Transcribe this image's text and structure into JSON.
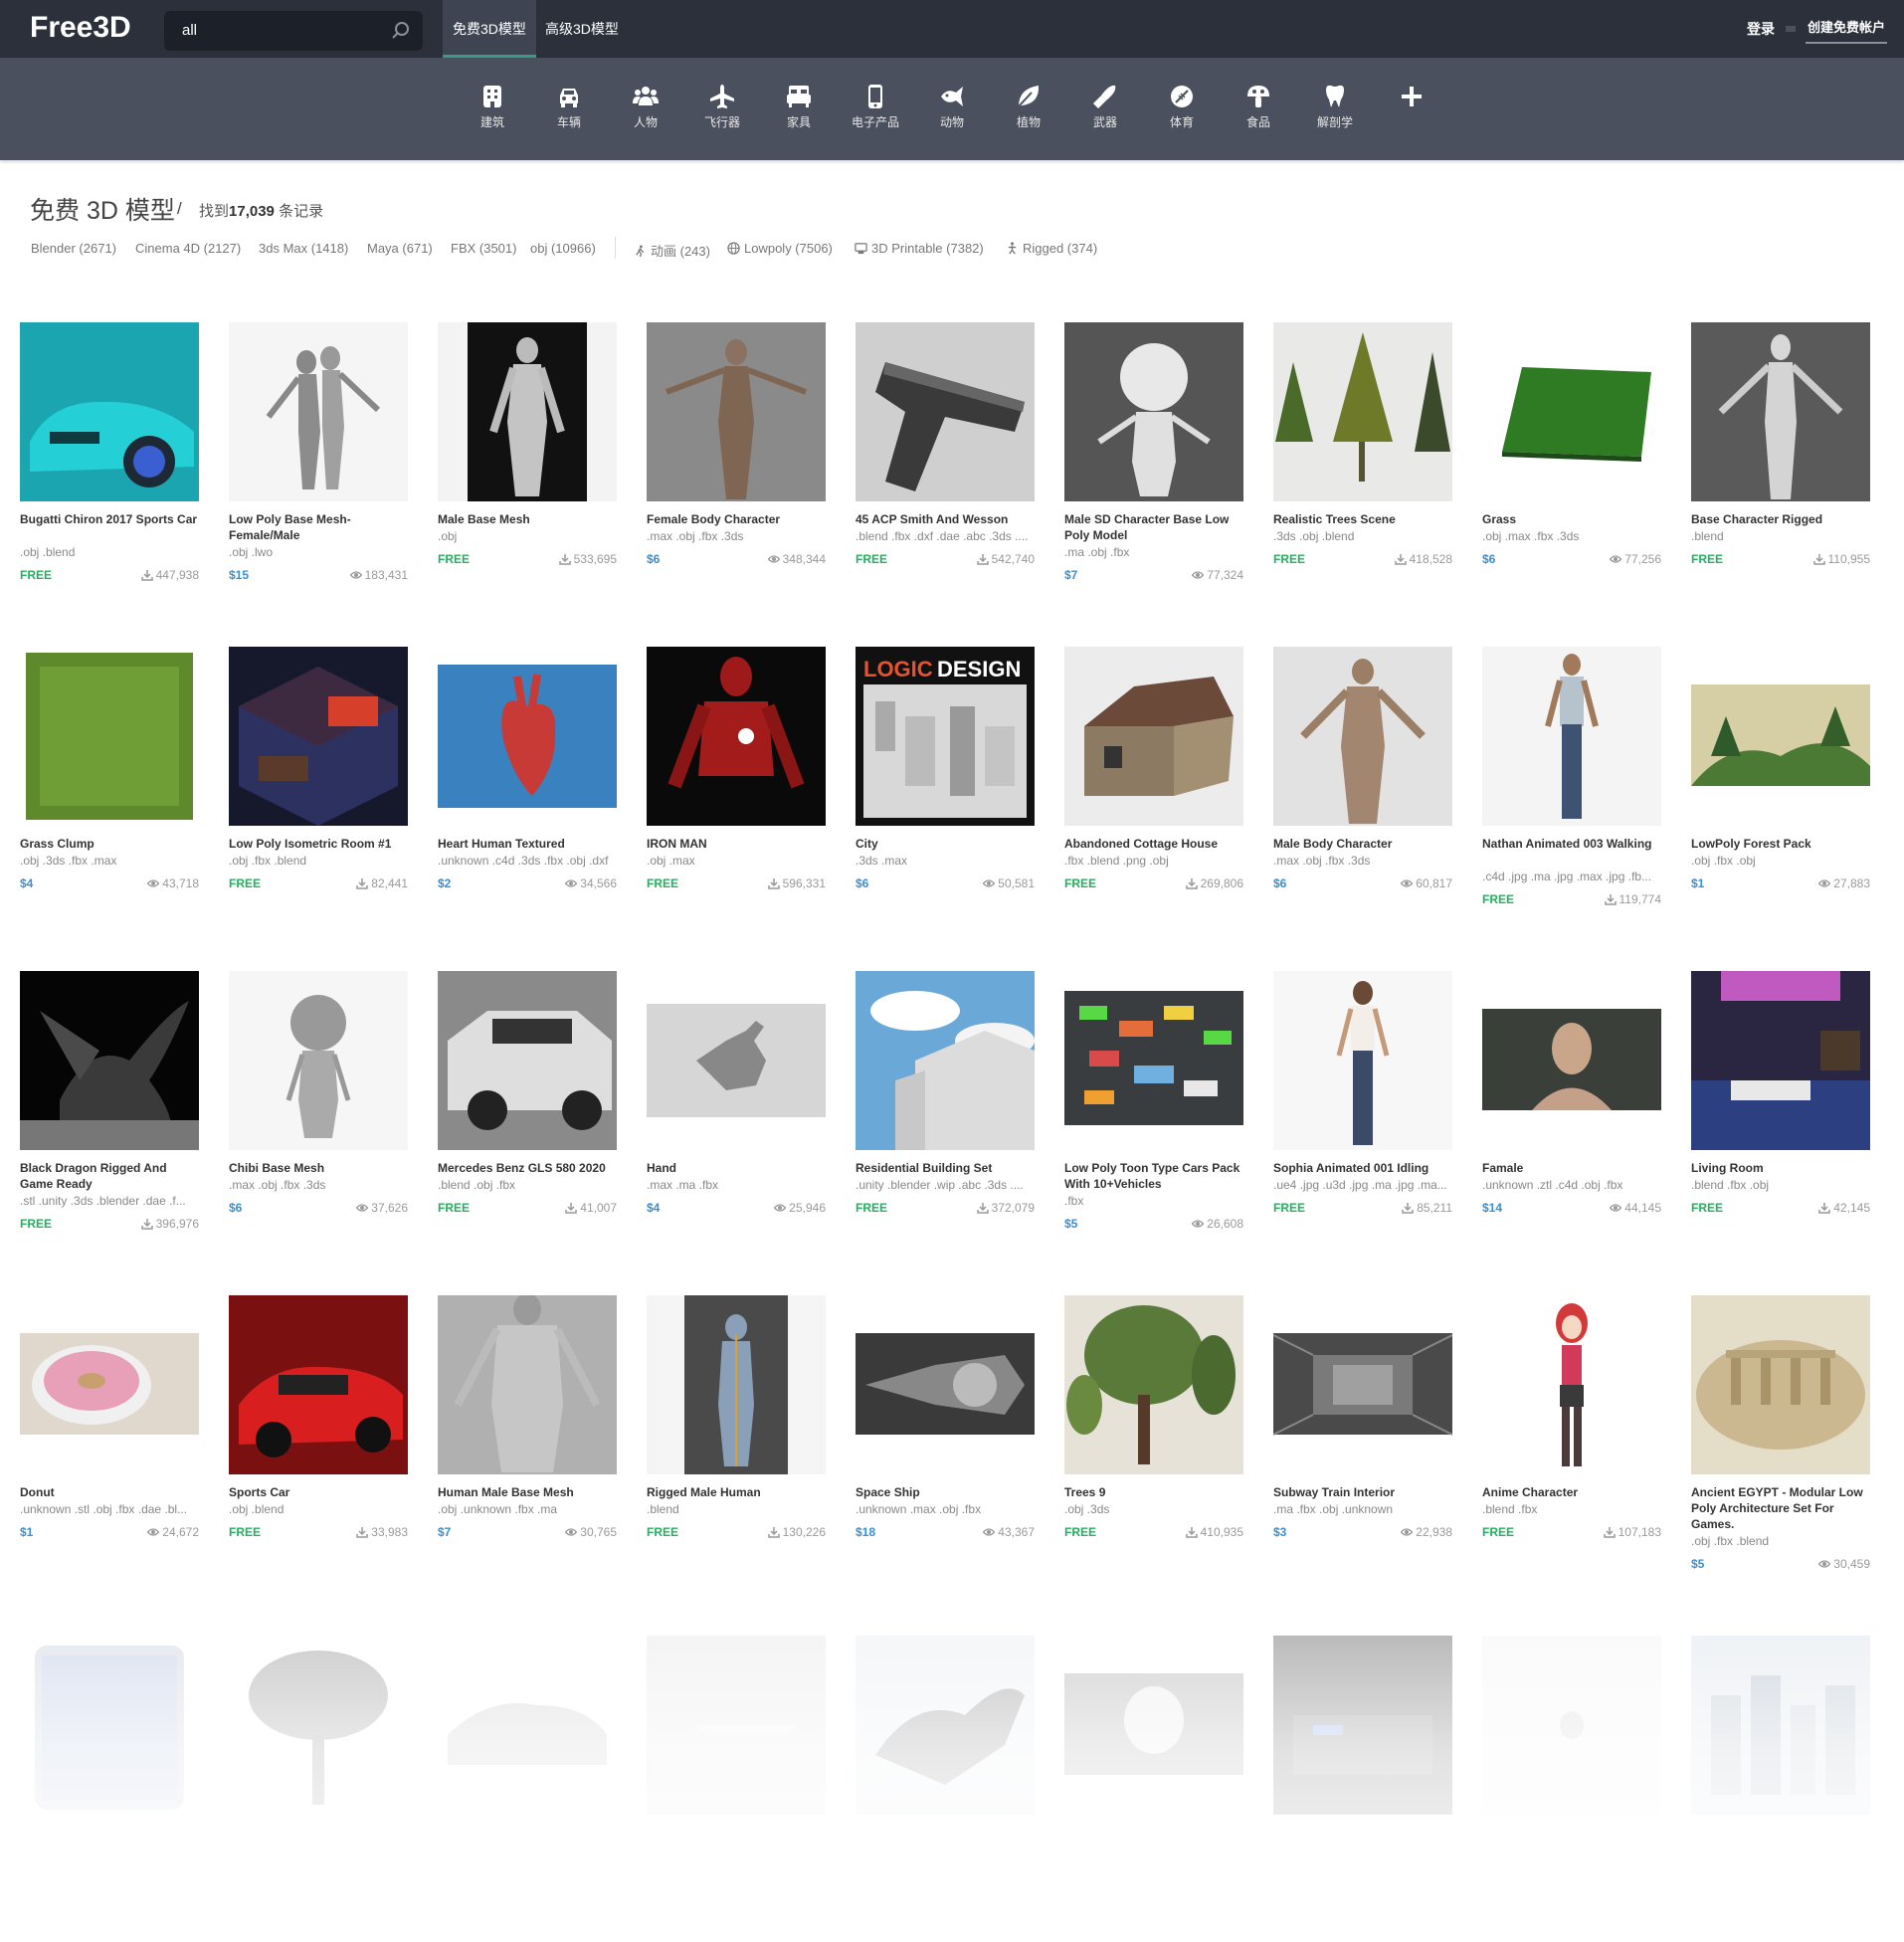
{
  "header": {
    "logo": "Free3D",
    "search_value": "all",
    "tabs": [
      "免费3D模型",
      "高级3D模型"
    ],
    "login": "登录",
    "create_account": "创建免费帐户"
  },
  "categories": [
    "建筑",
    "车辆",
    "人物",
    "飞行器",
    "家具",
    "电子产品",
    "动物",
    "植物",
    "武器",
    "体育",
    "食品",
    "解剖学",
    ""
  ],
  "page": {
    "title": "免费 3D 模型",
    "separator": "/",
    "found_prefix": "找到",
    "found_count": "17,039",
    "found_suffix": " 条记录"
  },
  "filters": [
    "Blender (2671)",
    "Cinema 4D (2127)",
    "3ds Max (1418)",
    "Maya (671)",
    "FBX (3501)",
    "obj (10966)",
    "动画 (243)",
    "Lowpoly (7506)",
    "3D Printable (7382)",
    "Rigged (374)"
  ],
  "models": [
    {
      "name": "Bugatti Chiron 2017 Sports Car",
      "formats": ".obj .blend",
      "price": "FREE",
      "stat": "447,938",
      "stat_type": "download"
    },
    {
      "name": "Low Poly Base Mesh- Female/Male",
      "formats": ".obj .lwo",
      "price": "$15",
      "stat": "183,431",
      "stat_type": "view"
    },
    {
      "name": "Male Base Mesh",
      "formats": ".obj",
      "price": "FREE",
      "stat": "533,695",
      "stat_type": "download"
    },
    {
      "name": "Female Body Character",
      "formats": ".max .obj .fbx .3ds",
      "price": "$6",
      "stat": "348,344",
      "stat_type": "view"
    },
    {
      "name": "45 ACP Smith And Wesson",
      "formats": ".blend .fbx .dxf .dae .abc .3ds ....",
      "price": "FREE",
      "stat": "542,740",
      "stat_type": "download"
    },
    {
      "name": "Male SD Character Base Low Poly Model",
      "formats": ".ma .obj .fbx",
      "price": "$7",
      "stat": "77,324",
      "stat_type": "view"
    },
    {
      "name": "Realistic Trees Scene",
      "formats": ".3ds .obj .blend",
      "price": "FREE",
      "stat": "418,528",
      "stat_type": "download"
    },
    {
      "name": "Grass",
      "formats": ".obj .max .fbx .3ds",
      "price": "$6",
      "stat": "77,256",
      "stat_type": "view"
    },
    {
      "name": "Base Character Rigged",
      "formats": ".blend",
      "price": "FREE",
      "stat": "110,955",
      "stat_type": "download"
    },
    {
      "name": "Grass Clump",
      "formats": ".obj .3ds .fbx .max",
      "price": "$4",
      "stat": "43,718",
      "stat_type": "view"
    },
    {
      "name": "Low Poly Isometric Room #1",
      "formats": ".obj .fbx .blend",
      "price": "FREE",
      "stat": "82,441",
      "stat_type": "download"
    },
    {
      "name": "Heart Human Textured",
      "formats": ".unknown .c4d .3ds .fbx .obj .dxf",
      "price": "$2",
      "stat": "34,566",
      "stat_type": "view"
    },
    {
      "name": "IRON MAN",
      "formats": ".obj .max",
      "price": "FREE",
      "stat": "596,331",
      "stat_type": "download"
    },
    {
      "name": "City",
      "formats": ".3ds .max",
      "price": "$6",
      "stat": "50,581",
      "stat_type": "view"
    },
    {
      "name": "Abandoned Cottage House",
      "formats": ".fbx .blend .png .obj",
      "price": "FREE",
      "stat": "269,806",
      "stat_type": "download"
    },
    {
      "name": "Male Body Character",
      "formats": ".max .obj .fbx .3ds",
      "price": "$6",
      "stat": "60,817",
      "stat_type": "view"
    },
    {
      "name": "Nathan Animated 003 Walking",
      "formats": ".c4d .jpg .ma .jpg .max .jpg .fb...",
      "price": "FREE",
      "stat": "119,774",
      "stat_type": "download"
    },
    {
      "name": "LowPoly Forest Pack",
      "formats": ".obj .fbx .obj",
      "price": "$1",
      "stat": "27,883",
      "stat_type": "view"
    },
    {
      "name": "Black Dragon Rigged And Game Ready",
      "formats": ".stl .unity .3ds .blender .dae .f...",
      "price": "FREE",
      "stat": "396,976",
      "stat_type": "download"
    },
    {
      "name": "Chibi Base Mesh",
      "formats": ".max .obj .fbx .3ds",
      "price": "$6",
      "stat": "37,626",
      "stat_type": "view"
    },
    {
      "name": "Mercedes Benz GLS 580 2020",
      "formats": ".blend .obj .fbx",
      "price": "FREE",
      "stat": "41,007",
      "stat_type": "download"
    },
    {
      "name": "Hand",
      "formats": ".max .ma .fbx",
      "price": "$4",
      "stat": "25,946",
      "stat_type": "view"
    },
    {
      "name": "Residential Building Set",
      "formats": ".unity .blender .wip .abc .3ds ....",
      "price": "FREE",
      "stat": "372,079",
      "stat_type": "download"
    },
    {
      "name": "Low Poly Toon Type Cars Pack With 10+Vehicles",
      "formats": ".fbx",
      "price": "$5",
      "stat": "26,608",
      "stat_type": "view"
    },
    {
      "name": "Sophia Animated 001 Idling",
      "formats": ".ue4 .jpg .u3d .jpg .ma .jpg .ma...",
      "price": "FREE",
      "stat": "85,211",
      "stat_type": "download"
    },
    {
      "name": "Famale",
      "formats": ".unknown .ztl .c4d .obj .fbx",
      "price": "$14",
      "stat": "44,145",
      "stat_type": "view"
    },
    {
      "name": "Living Room",
      "formats": ".blend .fbx .obj",
      "price": "FREE",
      "stat": "42,145",
      "stat_type": "download"
    },
    {
      "name": "Donut",
      "formats": ".unknown .stl .obj .fbx .dae .bl...",
      "price": "$1",
      "stat": "24,672",
      "stat_type": "view"
    },
    {
      "name": "Sports Car",
      "formats": ".obj .blend",
      "price": "FREE",
      "stat": "33,983",
      "stat_type": "download"
    },
    {
      "name": "Human Male Base Mesh",
      "formats": ".obj .unknown .fbx .ma",
      "price": "$7",
      "stat": "30,765",
      "stat_type": "view"
    },
    {
      "name": "Rigged Male Human",
      "formats": ".blend",
      "price": "FREE",
      "stat": "130,226",
      "stat_type": "download"
    },
    {
      "name": "Space Ship",
      "formats": ".unknown .max .obj .fbx",
      "price": "$18",
      "stat": "43,367",
      "stat_type": "view"
    },
    {
      "name": "Trees 9",
      "formats": ".obj .3ds",
      "price": "FREE",
      "stat": "410,935",
      "stat_type": "download"
    },
    {
      "name": "Subway Train Interior",
      "formats": ".ma .fbx .obj .unknown",
      "price": "$3",
      "stat": "22,938",
      "stat_type": "view"
    },
    {
      "name": "Anime Character",
      "formats": ".blend .fbx",
      "price": "FREE",
      "stat": "107,183",
      "stat_type": "download"
    },
    {
      "name": "Ancient EGYPT - Modular Low Poly Architecture Set For Games.",
      "formats": ".obj .fbx .blend",
      "price": "$5",
      "stat": "30,459",
      "stat_type": "view"
    }
  ],
  "colors": {
    "topbar": "#2b303b",
    "catbar": "#4a505d",
    "free": "#27ae60",
    "price": "#3a8fd0",
    "active_tab_underline": "#3a9a8a"
  }
}
